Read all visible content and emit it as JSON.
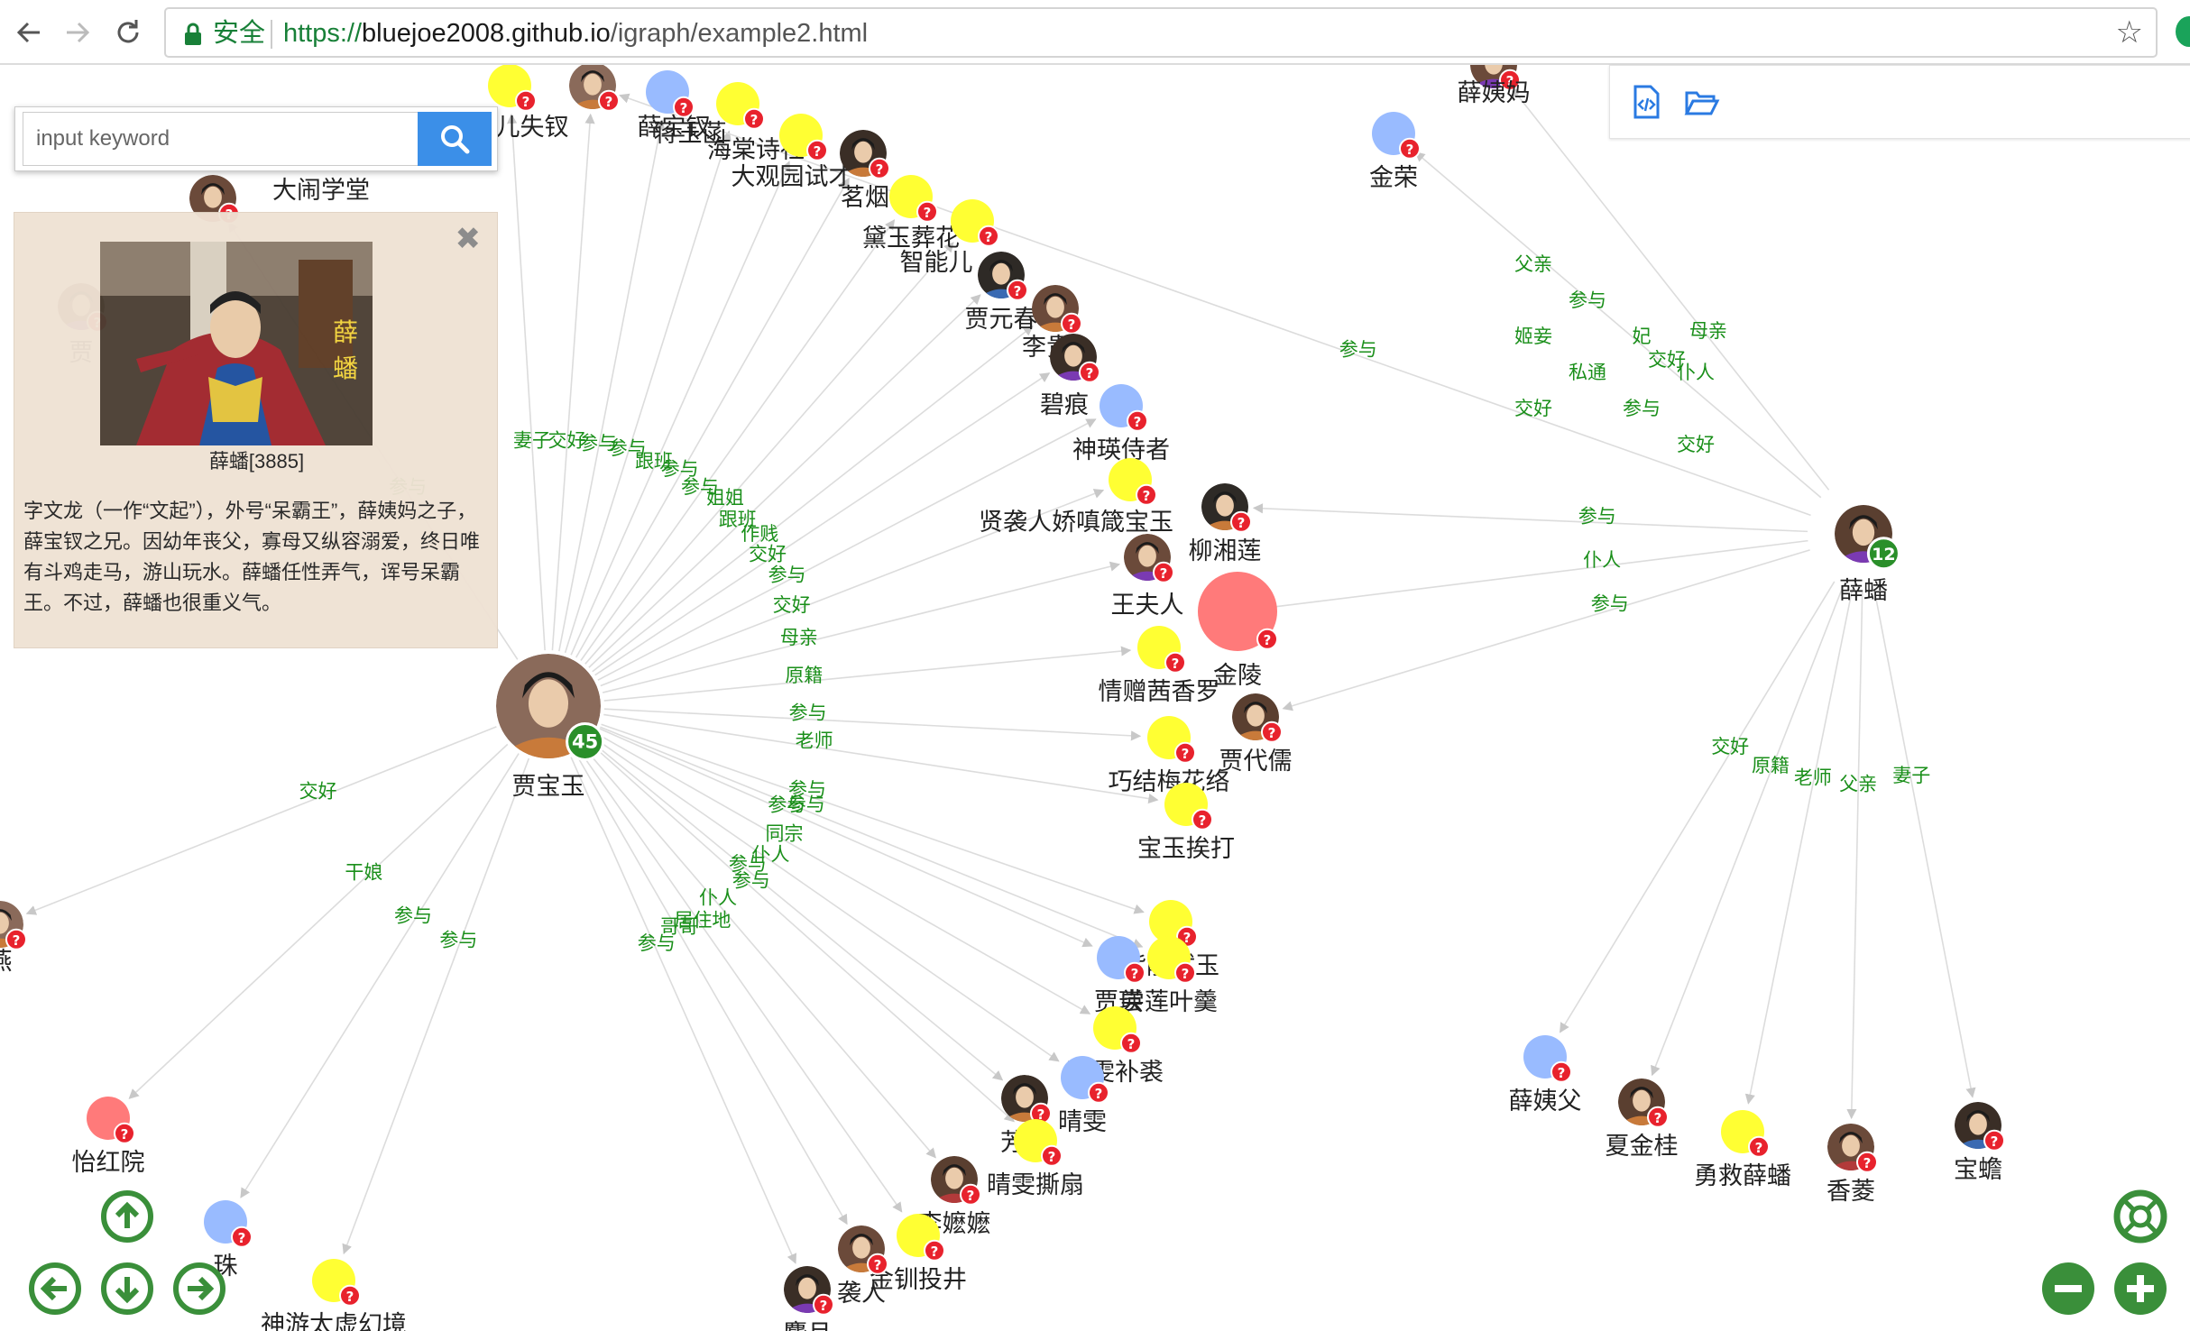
{
  "browser": {
    "secure_label": "安全",
    "url_scheme": "https://",
    "url_host": "bluejoe2008.github.io",
    "url_path": "/igraph/example2.html"
  },
  "search": {
    "placeholder": "input keyword"
  },
  "info_panel": {
    "title": "薛蟠[3885]",
    "description": "字文龙（一作“文起”），外号“呆霸王”，薛姨妈之子，薛宝钗之兄。因幼年丧父，寡母又纵容溺爱，终日唯有斗鸡走马，游山玩水。薛蟠任性弄气，诨号呆霸王。不过，薛蟠也很重义气。",
    "photo_caption_chars": [
      "薛",
      "蟠"
    ]
  },
  "colors": {
    "accent_blue": "#3b8fe8",
    "edge_label_green": "#1a8f1a",
    "count_badge_green": "#2a8f2a",
    "help_badge_red": "#e8222d",
    "node_yellow": "#ffff33",
    "node_blue": "#99bbff",
    "node_red": "#ff7a7a"
  },
  "graph": {
    "hubs": [
      {
        "id": "jby",
        "name": "贾宝玉",
        "count": "45",
        "style": "photo"
      },
      {
        "id": "xp",
        "name": "薛蟠",
        "count": "12",
        "style": "photo"
      }
    ],
    "nodes": [
      {
        "name": "大闹学堂",
        "style": "photo"
      },
      {
        "name": "儿失钗",
        "style": "yellow"
      },
      {
        "name": "薛宝钗",
        "style": "photo"
      },
      {
        "name": "蒋玉菡",
        "style": "blue"
      },
      {
        "name": "海棠诗社",
        "style": "yellow"
      },
      {
        "name": "大观园试才",
        "style": "yellow"
      },
      {
        "name": "茗烟",
        "style": "photo"
      },
      {
        "name": "黛玉葬花",
        "style": "yellow"
      },
      {
        "name": "智能儿",
        "style": "yellow"
      },
      {
        "name": "贾元春",
        "style": "photo"
      },
      {
        "name": "李贵",
        "style": "photo"
      },
      {
        "name": "碧痕",
        "style": "photo"
      },
      {
        "name": "神瑛侍者",
        "style": "blue"
      },
      {
        "name": "贤袭人娇嗔箴宝玉",
        "style": "yellow"
      },
      {
        "name": "柳湘莲",
        "style": "photo"
      },
      {
        "name": "王夫人",
        "style": "photo"
      },
      {
        "name": "金陵",
        "style": "red"
      },
      {
        "name": "情赠茜香罗",
        "style": "yellow"
      },
      {
        "name": "贾代儒",
        "style": "photo"
      },
      {
        "name": "巧结梅花络",
        "style": "yellow"
      },
      {
        "name": "宝玉挨打",
        "style": "yellow"
      },
      {
        "name": "紫鹃试玉",
        "style": "yellow"
      },
      {
        "name": "尝莲叶羹",
        "style": "yellow"
      },
      {
        "name": "贾瑛",
        "style": "blue"
      },
      {
        "name": "晴雯补裘",
        "style": "yellow"
      },
      {
        "name": "晴雯",
        "style": "blue"
      },
      {
        "name": "芳官",
        "style": "photo"
      },
      {
        "name": "晴雯撕扇",
        "style": "yellow"
      },
      {
        "name": "李嬷嬷",
        "style": "photo"
      },
      {
        "name": "金钏投井",
        "style": "yellow"
      },
      {
        "name": "袭人",
        "style": "photo"
      },
      {
        "name": "麝月",
        "style": "photo"
      },
      {
        "name": "神游太虚幻境",
        "style": "yellow"
      },
      {
        "name": "怡红院",
        "style": "red"
      },
      {
        "name": "珠",
        "style": "blue"
      },
      {
        "name": "薛姨妈",
        "style": "photo"
      },
      {
        "name": "金荣",
        "style": "blue"
      },
      {
        "name": "薛姨父",
        "style": "blue"
      },
      {
        "name": "夏金桂",
        "style": "photo"
      },
      {
        "name": "勇救薛蟠",
        "style": "yellow"
      },
      {
        "name": "香菱",
        "style": "photo"
      },
      {
        "name": "宝蟾",
        "style": "photo"
      },
      {
        "name": "燕",
        "style": "photo"
      },
      {
        "name": "贾",
        "style": "photo"
      }
    ],
    "edge_labels": [
      "参与",
      "妻子",
      "交好",
      "参与",
      "参与",
      "跟班",
      "参与",
      "参与",
      "姐姐",
      "跟班",
      "作贱",
      "交好",
      "参与",
      "交好",
      "母亲",
      "原籍",
      "参与",
      "老师",
      "参与",
      "参与",
      "参与",
      "同宗",
      "仆人",
      "参与",
      "参与",
      "仆人",
      "居住地",
      "哥哥",
      "参与",
      "参与",
      "干娘",
      "参与",
      "交好",
      "参与",
      "仆人",
      "参与",
      "母亲",
      "交好",
      "交好",
      "原籍",
      "老师",
      "父亲",
      "妻子",
      "参与",
      "姬妾",
      "私通",
      "参与",
      "交好",
      "父亲",
      "参与",
      "妃",
      "仆人",
      "交好"
    ]
  }
}
